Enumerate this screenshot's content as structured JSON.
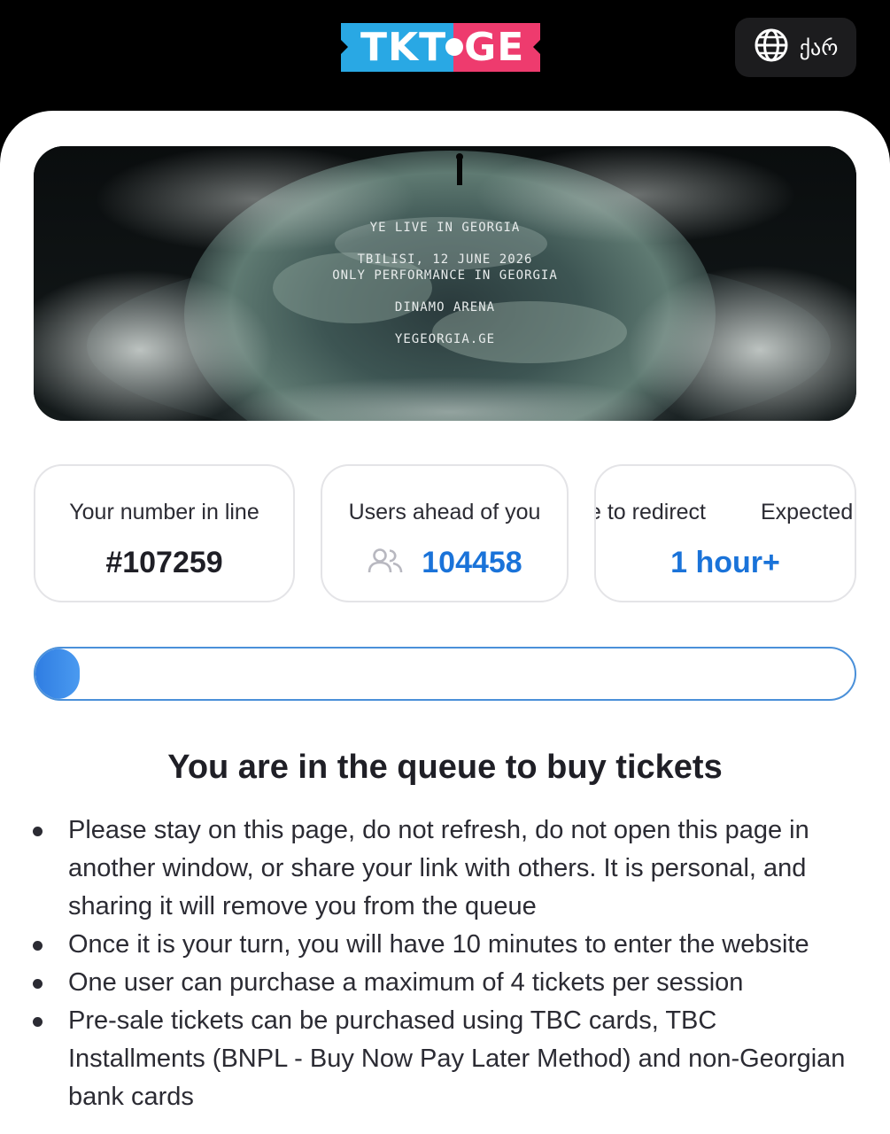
{
  "header": {
    "logo_left": "TKT",
    "logo_right": "GE",
    "language_label": "ქარ"
  },
  "banner": {
    "line1": "YE LIVE IN GEORGIA",
    "line2": "TBILISI, 12 JUNE 2026",
    "line3": "ONLY PERFORMANCE IN GEORGIA",
    "line4": "DINAMO ARENA",
    "line5": "YEGEORGIA.GE"
  },
  "stats": {
    "number_in_line_label": "Your number in line",
    "number_in_line_value": "#107259",
    "users_ahead_label": "Users ahead of you",
    "users_ahead_value": "104458",
    "redirect_label_left": "e to redirect",
    "redirect_label_right": "Expected",
    "redirect_value": "1 hour+"
  },
  "progress": {
    "fraction": 0.02
  },
  "queue": {
    "heading": "You are in the queue to buy tickets",
    "items": [
      "Please stay on this page, do not refresh, do not open this page in another window, or share your link with others. It is personal, and sharing it will remove you from the queue",
      "Once it is your turn, you will have 10 minutes to enter the website",
      "One user can purchase a maximum of 4 tickets per session",
      "Pre-sale tickets can be purchased using TBC cards, TBC Installments (BNPL - Buy Now Pay Later Method) and non-Georgian bank cards"
    ]
  },
  "colors": {
    "logo_blue": "#29a8e4",
    "logo_pink": "#ee3b6e",
    "accent_blue": "#2f7de2",
    "value_blue": "#1a73d9"
  }
}
